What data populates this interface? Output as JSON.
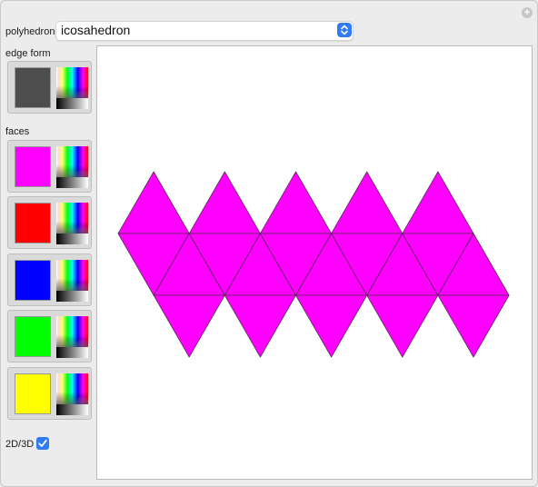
{
  "controls": {
    "polyhedron_label": "polyhedron",
    "polyhedron_value": "icosahedron",
    "edge_form_label": "edge form",
    "faces_label": "faces",
    "toggle_label": "2D/3D",
    "toggle_checked": true
  },
  "colors": {
    "edge": "#4d4d4d",
    "faces": [
      "#ff00ff",
      "#ff0000",
      "#0000ff",
      "#00ff00",
      "#ffff00"
    ],
    "net_fill": "#ff00ff",
    "net_stroke": "#5a2a5a",
    "accent": "#2f7cf6"
  },
  "icons": {
    "add": "plus-circle-icon",
    "select": "chevron-updown-icon",
    "check": "checkmark-icon"
  }
}
